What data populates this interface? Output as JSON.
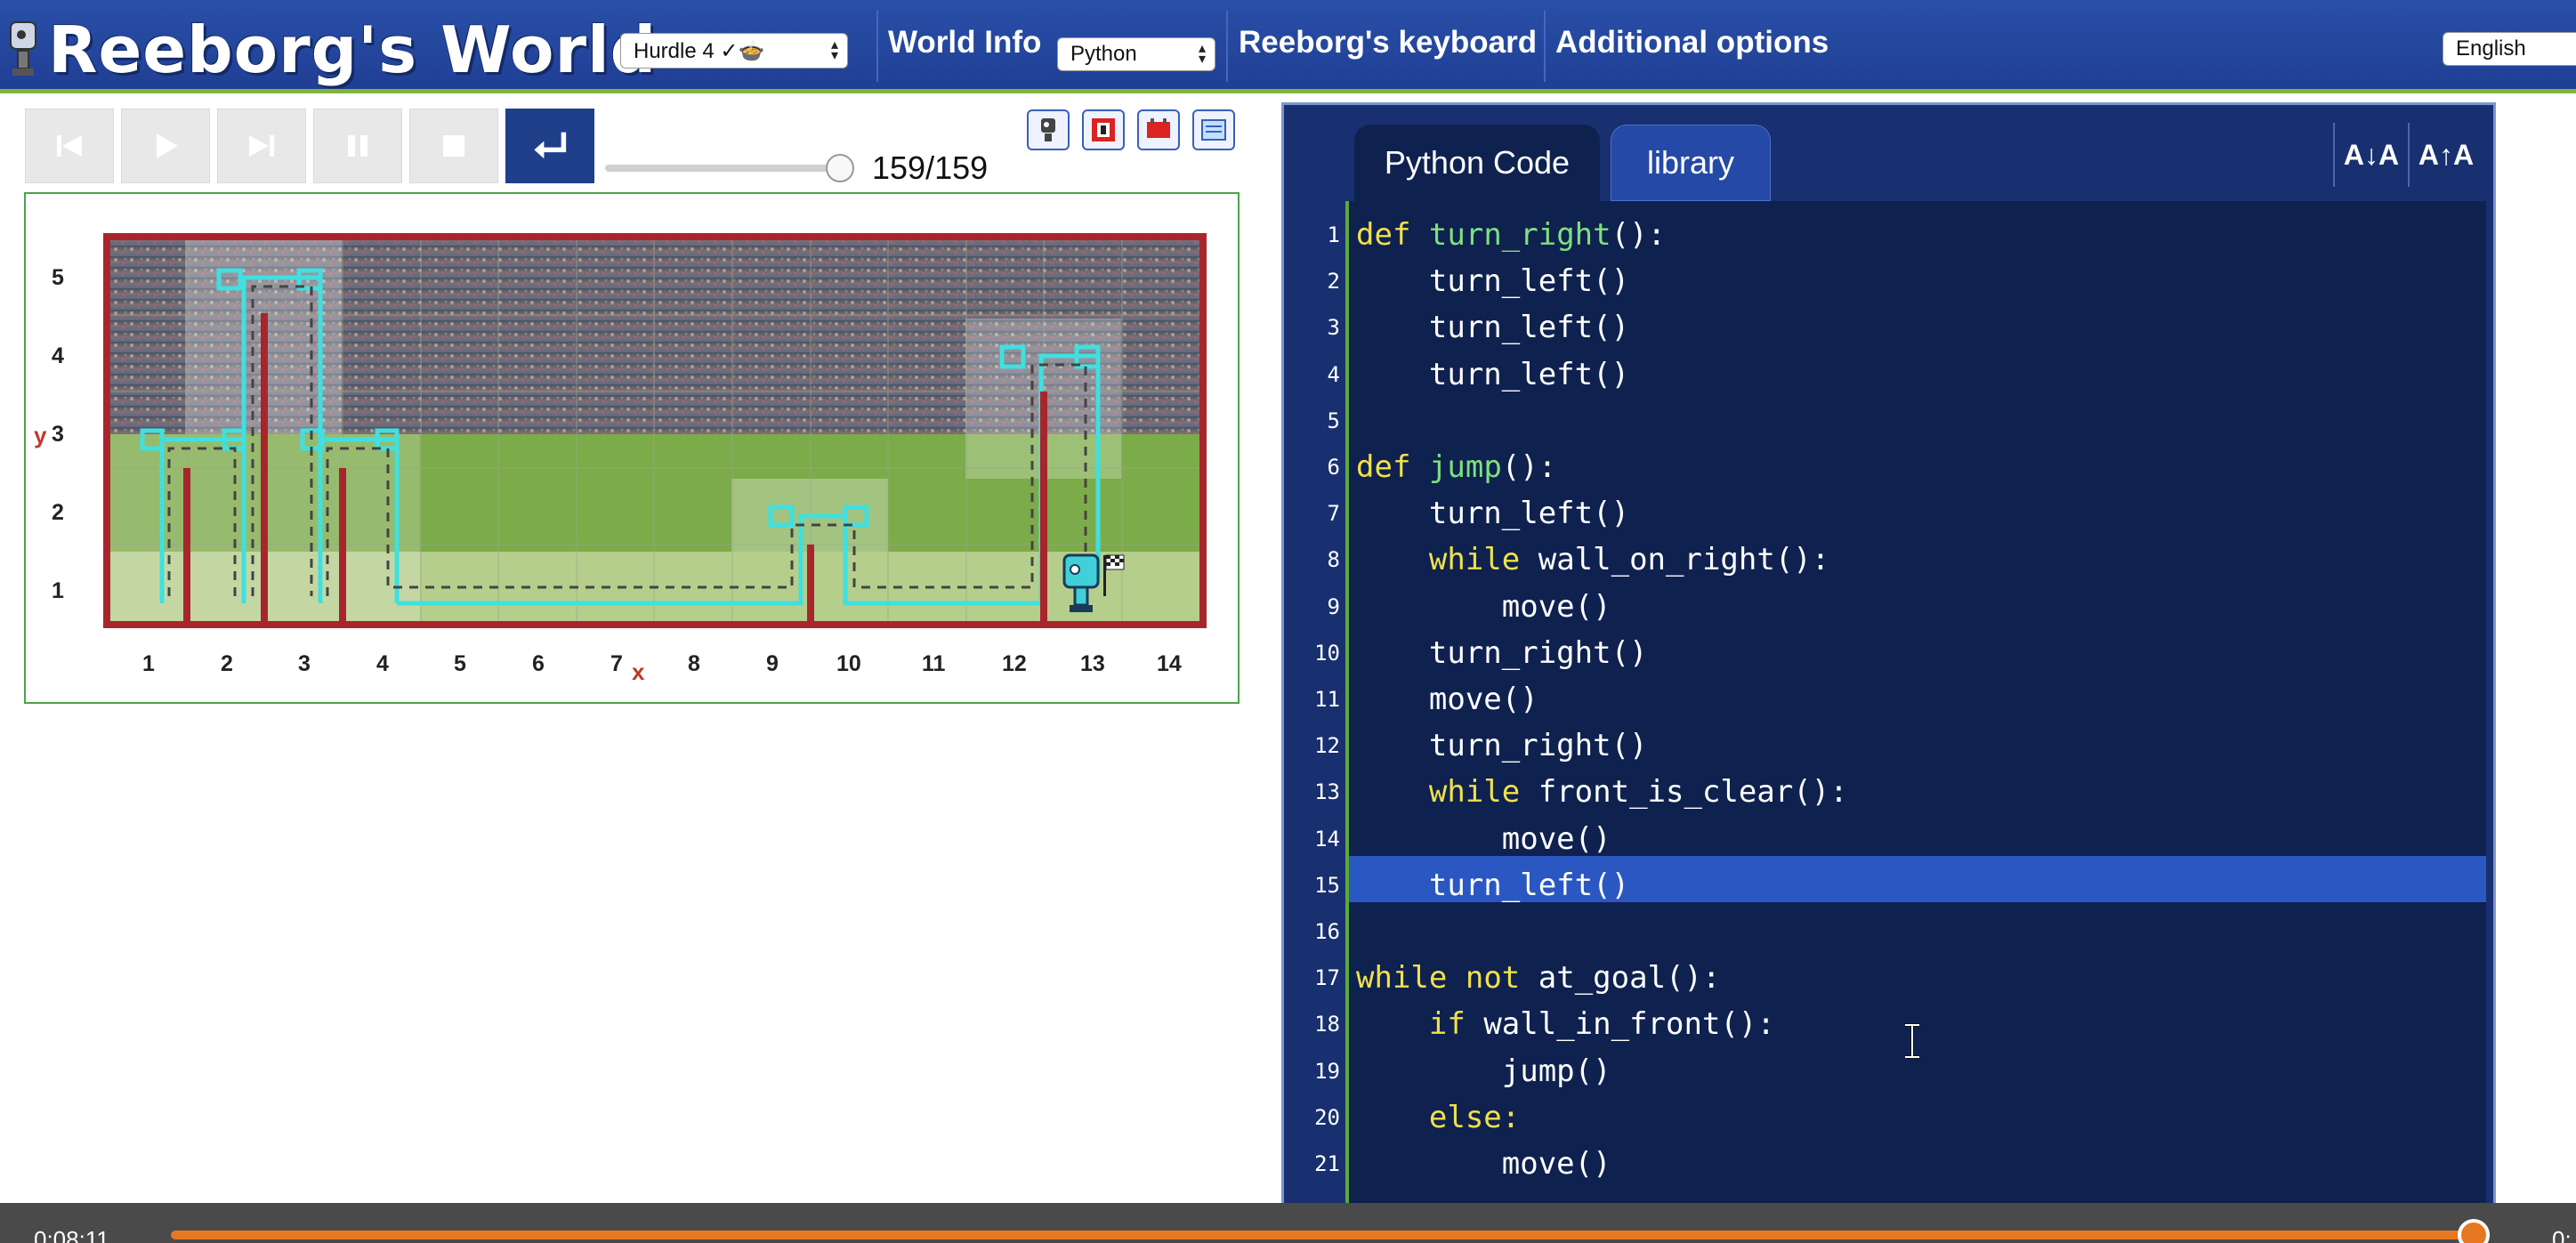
{
  "header": {
    "logo_text": "Reeborg's World",
    "world_select": "Hurdle 4 ✓🍲",
    "world_info": "World Info",
    "language_select": "Python",
    "keyboard": "Reeborg's keyboard",
    "options": "Additional options",
    "ui_language": "English"
  },
  "controls": {
    "buttons": [
      "reverse-step",
      "run",
      "step",
      "pause",
      "stop",
      "reload"
    ],
    "step_counter": "159/159",
    "slider_fraction": 1.0
  },
  "world": {
    "y_axis_label": "y",
    "x_axis_label": "x",
    "x_ticks": [
      "1",
      "2",
      "3",
      "4",
      "5",
      "6",
      "7",
      "8",
      "9",
      "10",
      "11",
      "12",
      "13",
      "14"
    ],
    "y_ticks": [
      "5",
      "4",
      "3",
      "2",
      "1"
    ]
  },
  "editor": {
    "tabs": [
      {
        "label": "Python Code",
        "active": true
      },
      {
        "label": "library",
        "active": false
      }
    ],
    "font_decrease": "A↓A",
    "font_increase": "A↑A",
    "highlighted_line": 15,
    "lines": [
      {
        "n": "1",
        "text": "def turn_right():"
      },
      {
        "n": "2",
        "text": "    turn_left()"
      },
      {
        "n": "3",
        "text": "    turn_left()"
      },
      {
        "n": "4",
        "text": "    turn_left()"
      },
      {
        "n": "5",
        "text": ""
      },
      {
        "n": "6",
        "text": "def jump():"
      },
      {
        "n": "7",
        "text": "    turn_left()"
      },
      {
        "n": "8",
        "text": "    while wall_on_right():"
      },
      {
        "n": "9",
        "text": "        move()"
      },
      {
        "n": "10",
        "text": "    turn_right()"
      },
      {
        "n": "11",
        "text": "    move()"
      },
      {
        "n": "12",
        "text": "    turn_right()"
      },
      {
        "n": "13",
        "text": "    while front_is_clear():"
      },
      {
        "n": "14",
        "text": "        move()"
      },
      {
        "n": "15",
        "text": "    turn_left()"
      },
      {
        "n": "16",
        "text": ""
      },
      {
        "n": "17",
        "text": "while not at_goal():"
      },
      {
        "n": "18",
        "text": "    if wall_in_front():"
      },
      {
        "n": "19",
        "text": "        jump()"
      },
      {
        "n": "20",
        "text": "    else:"
      },
      {
        "n": "21",
        "text": "        move()"
      }
    ]
  },
  "video": {
    "elapsed": "0:08:11",
    "remaining": "0:",
    "progress_fraction": 0.99
  },
  "colors": {
    "header_bg": "#1f3f94",
    "accent_green": "#7fb539",
    "editor_bg": "#0f214f",
    "keyword": "#f0e14a",
    "function_name": "#7ee07e",
    "trace": "#3fe0e0",
    "wall": "#a8262b",
    "video_progress": "#e87722"
  }
}
